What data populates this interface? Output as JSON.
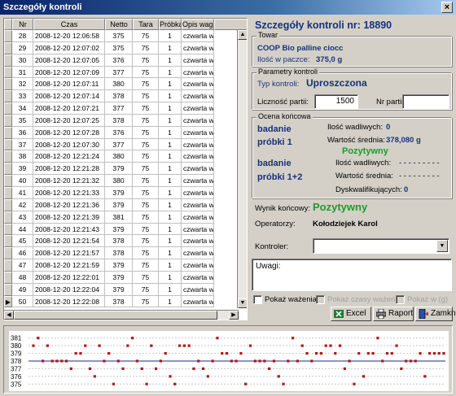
{
  "window": {
    "title": "Szczegóły kontroli",
    "close": "×"
  },
  "grid": {
    "columns": [
      "Nr",
      "Czas",
      "Netto",
      "Tara",
      "Próbka",
      "Opis wagi"
    ],
    "rows": [
      [
        "28",
        "2008-12-20 12:06:58",
        "375",
        "75",
        "1",
        "czwarta wa"
      ],
      [
        "29",
        "2008-12-20 12:07:02",
        "375",
        "75",
        "1",
        "czwarta wa"
      ],
      [
        "30",
        "2008-12-20 12:07:05",
        "376",
        "75",
        "1",
        "czwarta wa"
      ],
      [
        "31",
        "2008-12-20 12:07:09",
        "377",
        "75",
        "1",
        "czwarta wa"
      ],
      [
        "32",
        "2008-12-20 12:07:11",
        "380",
        "75",
        "1",
        "czwarta wa"
      ],
      [
        "33",
        "2008-12-20 12:07:14",
        "378",
        "75",
        "1",
        "czwarta wa"
      ],
      [
        "34",
        "2008-12-20 12:07:21",
        "377",
        "75",
        "1",
        "czwarta wa"
      ],
      [
        "35",
        "2008-12-20 12:07:25",
        "378",
        "75",
        "1",
        "czwarta wa"
      ],
      [
        "36",
        "2008-12-20 12:07:28",
        "376",
        "75",
        "1",
        "czwarta wa"
      ],
      [
        "37",
        "2008-12-20 12:07:30",
        "377",
        "75",
        "1",
        "czwarta wa"
      ],
      [
        "38",
        "2008-12-20 12:21:24",
        "380",
        "75",
        "1",
        "czwarta wa"
      ],
      [
        "39",
        "2008-12-20 12:21:28",
        "379",
        "75",
        "1",
        "czwarta wa"
      ],
      [
        "40",
        "2008-12-20 12:21:32",
        "380",
        "75",
        "1",
        "czwarta wa"
      ],
      [
        "41",
        "2008-12-20 12:21:33",
        "379",
        "75",
        "1",
        "czwarta wa"
      ],
      [
        "42",
        "2008-12-20 12:21:36",
        "379",
        "75",
        "1",
        "czwarta wa"
      ],
      [
        "43",
        "2008-12-20 12:21:39",
        "381",
        "75",
        "1",
        "czwarta wa"
      ],
      [
        "44",
        "2008-12-20 12:21:43",
        "379",
        "75",
        "1",
        "czwarta wa"
      ],
      [
        "45",
        "2008-12-20 12:21:54",
        "378",
        "75",
        "1",
        "czwarta wa"
      ],
      [
        "46",
        "2008-12-20 12:21:57",
        "378",
        "75",
        "1",
        "czwarta wa"
      ],
      [
        "47",
        "2008-12-20 12:21:59",
        "379",
        "75",
        "1",
        "czwarta wa"
      ],
      [
        "48",
        "2008-12-20 12:22:01",
        "379",
        "75",
        "1",
        "czwarta wa"
      ],
      [
        "49",
        "2008-12-20 12:22:04",
        "379",
        "75",
        "1",
        "czwarta wa"
      ],
      [
        "50",
        "2008-12-20 12:22:08",
        "378",
        "75",
        "1",
        "czwarta wa"
      ]
    ],
    "current_row_marker": "▶",
    "selected_row_index": 22
  },
  "panel": {
    "title": "Szczegóły kontroli nr: 18890",
    "towar": {
      "legend": "Towar",
      "name": "COOP Bio palline ciocc",
      "package_label": "Ilość w paczce:",
      "package_value": "375,0 g"
    },
    "parametry": {
      "legend": "Parametry kontroli",
      "type_label": "Typ kontroli:",
      "type_value": "Uproszczona",
      "lot_size_label": "Liczność partii:",
      "lot_size_value": "1500",
      "lot_no_label": "Nr partii:",
      "lot_no_value": ""
    },
    "ocena": {
      "legend": "Ocena końcowa",
      "sample1_line1": "badanie",
      "sample1_line2": "próbki 1",
      "defects_label": "Ilość wadliwych:",
      "defects_value": "0",
      "mean_label": "Wartość średnia:",
      "mean_value": "378,080 g",
      "sample1_result": "Pozytywny",
      "sample12_line1": "badanie",
      "sample12_line2": "próbki 1+2",
      "defects2_label": "Ilość wadliwych:",
      "defects2_value": "- - - - - - - - -",
      "mean2_label": "Wartość średnia:",
      "mean2_value": "- - - - - - - - -",
      "disq_label": "Dyskwalifikujących:",
      "disq_value": "0"
    },
    "final_label": "Wynik końcowy:",
    "final_value": "Pozytywny",
    "operator_label": "Operatorzy:",
    "operator_value": "Kołodziejek Karol",
    "controller_label": "Kontroler:",
    "controller_value": "",
    "notes_label": "Uwagi:",
    "notes_value": "",
    "check_weighing": "Pokaż ważenia",
    "check_times": "Pokaż czasy ważeń",
    "check_g": "Pokaż w (g)",
    "btn_excel": "Excel",
    "btn_report": "Raport",
    "btn_close": "Zamknij",
    "colors": {
      "title_blue": "#16327a",
      "result_green": "#1e9a2c"
    }
  },
  "chart_data": {
    "type": "scatter",
    "title": "",
    "xlabel": "",
    "ylabel": "",
    "y_tick_labels": [
      "381",
      "380",
      "379",
      "378",
      "377",
      "376",
      "375"
    ],
    "ylim": [
      374.5,
      381.5
    ],
    "reference_line": 378,
    "series": [
      {
        "values": [
          380,
          381,
          378,
          380,
          378,
          378,
          378,
          378,
          377,
          379,
          379,
          380,
          377,
          376,
          380,
          378,
          379,
          375,
          378,
          377,
          380,
          381,
          378,
          377,
          375,
          380,
          377,
          378,
          379,
          376,
          375,
          380,
          380,
          380,
          377,
          378,
          377,
          376,
          378,
          381,
          379,
          379,
          378,
          378,
          379,
          375,
          380,
          378,
          378,
          378,
          377,
          378,
          376,
          375,
          378,
          381,
          378,
          380,
          379,
          378,
          379,
          379,
          380,
          380,
          379,
          380,
          377,
          378,
          375,
          379,
          376,
          379,
          379,
          381,
          378,
          379,
          379,
          380,
          377,
          378,
          378,
          378,
          379,
          376,
          379,
          379,
          379,
          379
        ]
      }
    ],
    "grid": true,
    "colors": {
      "points": "#b01818",
      "reference": "#1e2a8a"
    }
  }
}
